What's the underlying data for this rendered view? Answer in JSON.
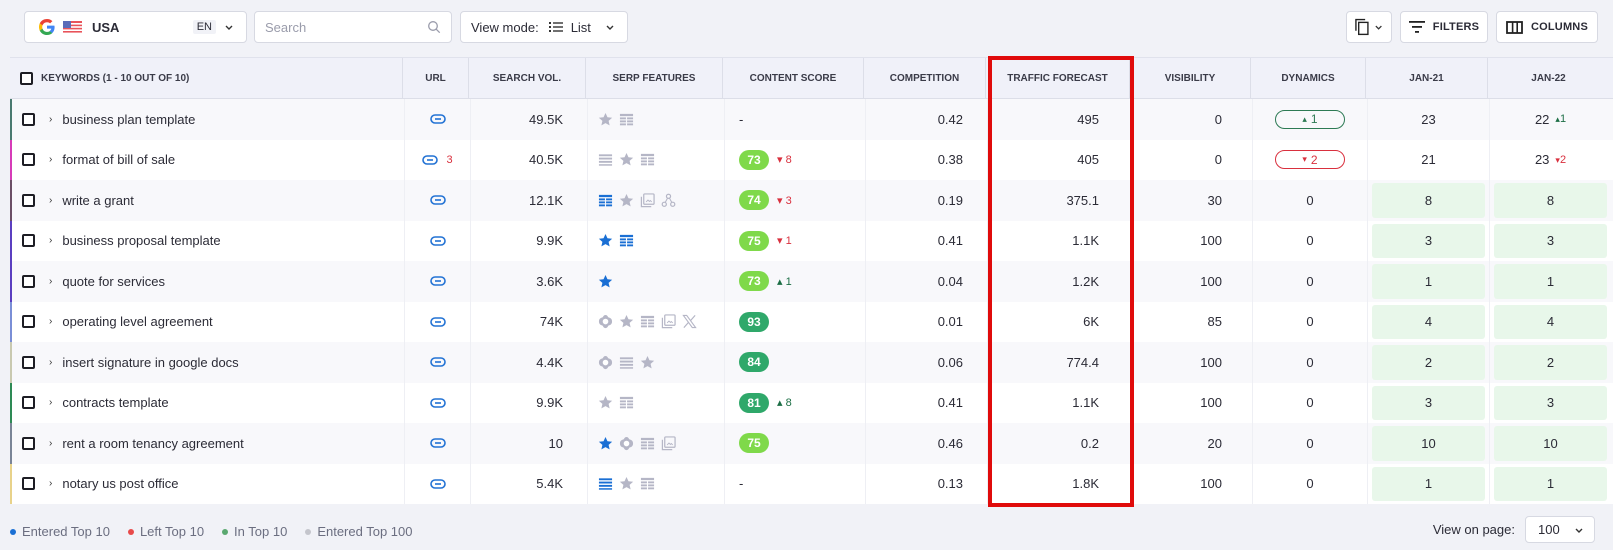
{
  "toolbar": {
    "region": {
      "engine_icon": "google-logo-icon",
      "flag_icon": "us-flag-icon",
      "country": "USA",
      "language": "EN"
    },
    "search": {
      "placeholder": "Search",
      "value": ""
    },
    "view_mode": {
      "label": "View mode:",
      "value": "List",
      "icon": "list-icon"
    },
    "copy_icon": "copy-icon",
    "filters_label": "FILTERS",
    "columns_label": "COLUMNS"
  },
  "table": {
    "columns": {
      "keywords": "KEYWORDS (1 - 10 OUT OF 10)",
      "url": "URL",
      "search_vol": "SEARCH VOL.",
      "serp_features": "SERP FEATURES",
      "content_score": "CONTENT SCORE",
      "competition": "COMPETITION",
      "traffic_forecast": "TRAFFIC FORECAST",
      "visibility": "VISIBILITY",
      "dynamics": "DYNAMICS",
      "jan21": "JAN-21",
      "jan22": "JAN-22"
    },
    "rows": [
      {
        "keyword": "business plan template",
        "accent": "#4a7a70",
        "url_count": "",
        "search_vol": "49.5K",
        "serp": [
          {
            "icon": "star",
            "active": false
          },
          {
            "icon": "table",
            "active": false
          }
        ],
        "content_score": "-",
        "score_color": "",
        "cs_delta": "",
        "cs_dir": "",
        "competition": "0.42",
        "traffic_forecast": "495",
        "visibility": "0",
        "dynamics": "1",
        "dyn_dir": "up",
        "jan21": "23",
        "jan21_green": false,
        "jan22": "22",
        "jan22_delta": "1",
        "jan22_dir": "up",
        "jan22_green": false
      },
      {
        "keyword": "format of bill of sale",
        "accent": "#d63bb8",
        "url_count": "3",
        "search_vol": "40.5K",
        "serp": [
          {
            "icon": "list",
            "active": false
          },
          {
            "icon": "star",
            "active": false
          },
          {
            "icon": "table",
            "active": false
          }
        ],
        "content_score": "73",
        "score_color": "#7fd94a",
        "cs_delta": "8",
        "cs_dir": "down",
        "competition": "0.38",
        "traffic_forecast": "405",
        "visibility": "0",
        "dynamics": "2",
        "dyn_dir": "down",
        "jan21": "21",
        "jan21_green": false,
        "jan22": "23",
        "jan22_delta": "2",
        "jan22_dir": "down",
        "jan22_green": false
      },
      {
        "keyword": "write a grant",
        "accent": "#6b4e66",
        "url_count": "",
        "search_vol": "12.1K",
        "serp": [
          {
            "icon": "table",
            "active": true
          },
          {
            "icon": "star",
            "active": false
          },
          {
            "icon": "images",
            "active": false
          },
          {
            "icon": "graph",
            "active": false
          }
        ],
        "content_score": "74",
        "score_color": "#7fd94a",
        "cs_delta": "3",
        "cs_dir": "down",
        "competition": "0.19",
        "traffic_forecast": "375.1",
        "visibility": "30",
        "dynamics": "0",
        "dyn_dir": "",
        "jan21": "8",
        "jan21_green": true,
        "jan22": "8",
        "jan22_delta": "",
        "jan22_dir": "",
        "jan22_green": true
      },
      {
        "keyword": "business proposal template",
        "accent": "#5b3fc0",
        "url_count": "",
        "search_vol": "9.9K",
        "serp": [
          {
            "icon": "star",
            "active": true
          },
          {
            "icon": "table",
            "active": true
          }
        ],
        "content_score": "75",
        "score_color": "#7fd94a",
        "cs_delta": "1",
        "cs_dir": "down",
        "competition": "0.41",
        "traffic_forecast": "1.1K",
        "visibility": "100",
        "dynamics": "0",
        "dyn_dir": "",
        "jan21": "3",
        "jan21_green": true,
        "jan22": "3",
        "jan22_delta": "",
        "jan22_dir": "",
        "jan22_green": true
      },
      {
        "keyword": "quote for services",
        "accent": "#5b3fc0",
        "url_count": "",
        "search_vol": "3.6K",
        "serp": [
          {
            "icon": "star",
            "active": true
          }
        ],
        "content_score": "73",
        "score_color": "#7fd94a",
        "cs_delta": "1",
        "cs_dir": "up",
        "competition": "0.04",
        "traffic_forecast": "1.2K",
        "visibility": "100",
        "dynamics": "0",
        "dyn_dir": "",
        "jan21": "1",
        "jan21_green": true,
        "jan22": "1",
        "jan22_delta": "",
        "jan22_dir": "",
        "jan22_green": true
      },
      {
        "keyword": "operating level agreement",
        "accent": "#7a8ed6",
        "url_count": "",
        "search_vol": "74K",
        "serp": [
          {
            "icon": "knowledge",
            "active": false
          },
          {
            "icon": "star",
            "active": false
          },
          {
            "icon": "table",
            "active": false
          },
          {
            "icon": "images",
            "active": false
          },
          {
            "icon": "x",
            "active": false
          }
        ],
        "content_score": "93",
        "score_color": "#2fa86a",
        "cs_delta": "",
        "cs_dir": "",
        "competition": "0.01",
        "traffic_forecast": "6K",
        "visibility": "85",
        "dynamics": "0",
        "dyn_dir": "",
        "jan21": "4",
        "jan21_green": true,
        "jan22": "4",
        "jan22_delta": "",
        "jan22_dir": "",
        "jan22_green": true
      },
      {
        "keyword": "insert signature in google docs",
        "accent": "#c9c9b0",
        "url_count": "",
        "search_vol": "4.4K",
        "serp": [
          {
            "icon": "knowledge",
            "active": false
          },
          {
            "icon": "list",
            "active": false
          },
          {
            "icon": "star",
            "active": false
          }
        ],
        "content_score": "84",
        "score_color": "#2fa86a",
        "cs_delta": "",
        "cs_dir": "",
        "competition": "0.06",
        "traffic_forecast": "774.4",
        "visibility": "100",
        "dynamics": "0",
        "dyn_dir": "",
        "jan21": "2",
        "jan21_green": true,
        "jan22": "2",
        "jan22_delta": "",
        "jan22_dir": "",
        "jan22_green": true
      },
      {
        "keyword": "contracts template",
        "accent": "#2e8a55",
        "url_count": "",
        "search_vol": "9.9K",
        "serp": [
          {
            "icon": "star",
            "active": false
          },
          {
            "icon": "table",
            "active": false
          }
        ],
        "content_score": "81",
        "score_color": "#2fa86a",
        "cs_delta": "8",
        "cs_dir": "up",
        "competition": "0.41",
        "traffic_forecast": "1.1K",
        "visibility": "100",
        "dynamics": "0",
        "dyn_dir": "",
        "jan21": "3",
        "jan21_green": true,
        "jan22": "3",
        "jan22_delta": "",
        "jan22_dir": "",
        "jan22_green": true
      },
      {
        "keyword": "rent a room tenancy agreement",
        "accent": "#7a8496",
        "url_count": "",
        "search_vol": "10",
        "serp": [
          {
            "icon": "star",
            "active": true
          },
          {
            "icon": "knowledge",
            "active": false
          },
          {
            "icon": "table",
            "active": false
          },
          {
            "icon": "images",
            "active": false
          }
        ],
        "content_score": "75",
        "score_color": "#7fd94a",
        "cs_delta": "",
        "cs_dir": "",
        "competition": "0.46",
        "traffic_forecast": "0.2",
        "visibility": "20",
        "dynamics": "0",
        "dyn_dir": "",
        "jan21": "10",
        "jan21_green": true,
        "jan22": "10",
        "jan22_delta": "",
        "jan22_dir": "",
        "jan22_green": true
      },
      {
        "keyword": "notary us post office",
        "accent": "#e8d28a",
        "url_count": "",
        "search_vol": "5.4K",
        "serp": [
          {
            "icon": "list",
            "active": true
          },
          {
            "icon": "star",
            "active": false
          },
          {
            "icon": "table",
            "active": false
          }
        ],
        "content_score": "-",
        "score_color": "",
        "cs_delta": "",
        "cs_dir": "",
        "competition": "0.13",
        "traffic_forecast": "1.8K",
        "visibility": "100",
        "dynamics": "0",
        "dyn_dir": "",
        "jan21": "1",
        "jan21_green": true,
        "jan22": "1",
        "jan22_delta": "",
        "jan22_dir": "",
        "jan22_green": true
      }
    ]
  },
  "highlight": {
    "column": "traffic_forecast",
    "color": "#e00b0b"
  },
  "legend": [
    {
      "label": "Entered Top 10",
      "color": "#1a6fd4"
    },
    {
      "label": "Left Top 10",
      "color": "#e84a4a"
    },
    {
      "label": "In Top 10",
      "color": "#5aa870"
    },
    {
      "label": "Entered Top 100",
      "color": "#c4c5cc"
    }
  ],
  "pager": {
    "label": "View on page:",
    "value": "100"
  },
  "colors": {
    "active_icon": "#1a6fd4",
    "inactive_icon": "#b5b6c6",
    "link_icon": "#2272d4",
    "up": "#1c6e45",
    "down": "#d9303e"
  }
}
